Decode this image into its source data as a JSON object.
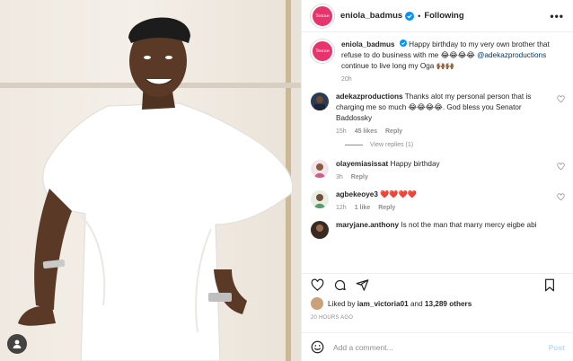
{
  "post": {
    "author": "eniola_badmus",
    "avatar_text": "Tenne",
    "follow_label": "Following",
    "more_label": "•••",
    "separator": "•"
  },
  "caption": {
    "username": "eniola_badmus",
    "text_before": "Happy birthday to my very own brother that refuse to do business with me 😂😂😂😂",
    "mention": "@adekazproductions",
    "text_after": "continue to live long my Oga 🙌🏾🙌🏾",
    "time": "20h"
  },
  "comments": [
    {
      "username": "adekazproductions",
      "text": "Thanks alot my personal person that is charging me so much 😂😂😂😂. God bless you Senator Baddossky",
      "time": "15h",
      "likes": "45 likes",
      "reply": "Reply",
      "view_replies": "View replies (1)"
    },
    {
      "username": "olayemiasissat",
      "text": "Happy birthday",
      "time": "3h",
      "reply": "Reply"
    },
    {
      "username": "agbekeoye3",
      "text": "❤️❤️❤️❤️",
      "time": "12h",
      "likes": "1 like",
      "reply": "Reply"
    },
    {
      "username": "maryjane.anthony",
      "text": "Is not the man that marry mercy eigbe abi"
    }
  ],
  "likes": {
    "liked_by_prefix": "Liked by",
    "liked_by_user": "iam_victoria01",
    "and": "and",
    "others": "13,289 others"
  },
  "timestamp": "20 HOURS AGO",
  "add_comment": {
    "placeholder": "Add a comment...",
    "post_label": "Post"
  },
  "colors": {
    "accent": "#0095f6",
    "post_disabled": "#b2dffc",
    "avatar_pink": "#e8336d",
    "heart_red": "#ed4956"
  }
}
